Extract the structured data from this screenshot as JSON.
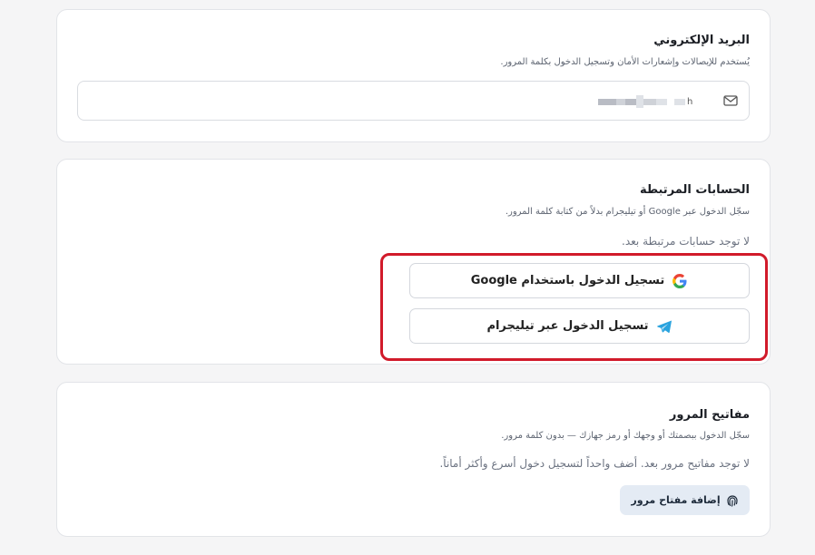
{
  "email_section": {
    "title": "البريد الإلكتروني",
    "subtitle": "يُستخدم للإيصالات وإشعارات الأمان وتسجيل الدخول بكلمة المرور.",
    "value_suffix": "h"
  },
  "linked_accounts": {
    "title": "الحسابات المرتبطة",
    "subtitle": "سجّل الدخول عبر Google أو تيليجرام بدلاً من كتابة كلمة المرور.",
    "empty_text": "لا توجد حسابات مرتبطة بعد.",
    "google_button_label": "تسجيل الدخول باستخدام Google",
    "telegram_button_label": "تسجيل الدخول عبر تيليجرام",
    "highlight_color": "#d11a2a"
  },
  "passkeys": {
    "title": "مفاتيح المرور",
    "subtitle": "سجّل الدخول ببصمتك أو وجهك أو رمز جهازك — بدون كلمة مرور.",
    "empty_text": "لا توجد مفاتيح مرور بعد. أضف واحداً لتسجيل دخول أسرع وأكثر أماناً.",
    "add_button_label": "إضافة مفتاح مرور"
  },
  "icons": {
    "email": "mail-icon",
    "google": "google-icon",
    "telegram": "telegram-icon",
    "passkey": "fingerprint-icon"
  }
}
